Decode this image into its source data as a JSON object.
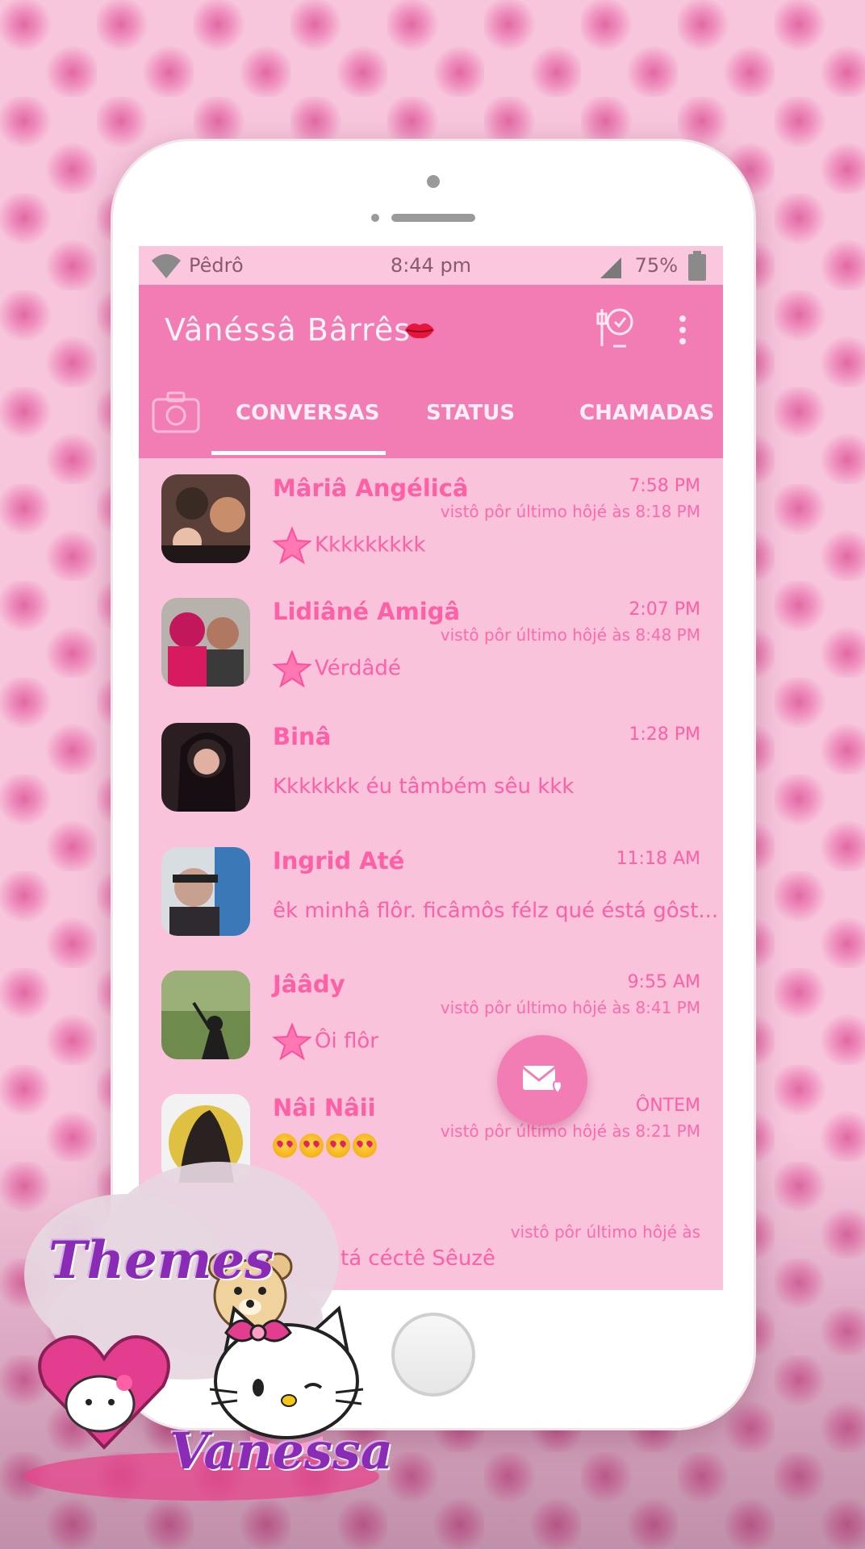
{
  "status_bar": {
    "carrier": "Pêdrô",
    "time": "8:44 pm",
    "battery": "75%"
  },
  "header": {
    "title": "Vânéssâ Bârrês"
  },
  "tabs": {
    "chats": "CONVERSAS",
    "status": "STATUS",
    "calls": "CHAMADAS"
  },
  "chats": [
    {
      "name": "Mâriâ Angélicâ",
      "time": "7:58 PM",
      "last_seen": "vistô pôr último hôjé às 8:18 PM",
      "message": "Kkkkkkkkk",
      "starred": true
    },
    {
      "name": "Lidiâné Amigâ",
      "time": "2:07 PM",
      "last_seen": "vistô pôr último hôjé às 8:48 PM",
      "message": "Vérdâdé",
      "starred": true
    },
    {
      "name": "Binâ",
      "time": "1:28 PM",
      "last_seen": "",
      "message": "Kkkkkkk éu tâmbém sêu kkk",
      "starred": false
    },
    {
      "name": "Ingrid Até",
      "time": "11:18 AM",
      "last_seen": "",
      "message": "êk minhâ flôr. ficâmôs félz qué éstá gôst...",
      "starred": false
    },
    {
      "name": "Jââdy",
      "time": "9:55 AM",
      "last_seen": "vistô pôr último hôjé às 8:41 PM",
      "message": "Ôi flôr",
      "starred": true
    },
    {
      "name": "Nâi Nâii",
      "time": "ÔNTEM",
      "last_seen": "vistô pôr último hôjé às 8:21 PM",
      "message": "",
      "starred": false
    },
    {
      "name": "",
      "time": "",
      "last_seen": "vistô pôr último hôjé às",
      "message": "tá céctê Sêuzê",
      "starred": false
    }
  ],
  "sticker": {
    "line1": "Themes",
    "line2": "Vanessa"
  },
  "colors": {
    "accent": "#f27db4",
    "screen_bg": "#f9c3dc",
    "text_pink": "#ff5fa5"
  }
}
